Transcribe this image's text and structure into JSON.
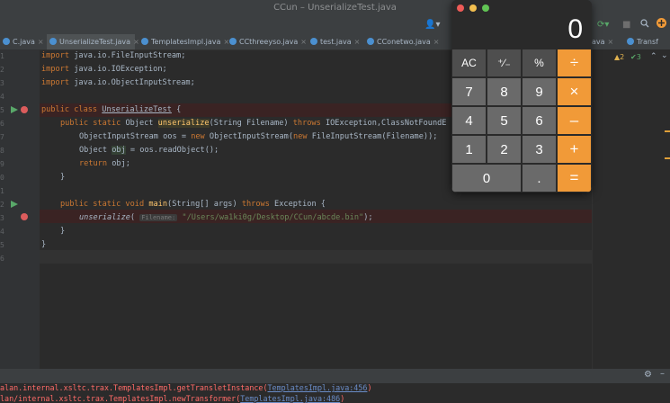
{
  "window": {
    "title": "CCun – UnserializeTest.java"
  },
  "tabs": [
    {
      "label": "C.java"
    },
    {
      "label": "UnserializeTest.java"
    },
    {
      "label": "TemplatesImpl.java"
    },
    {
      "label": "CCthreeyso.java"
    },
    {
      "label": "test.java"
    },
    {
      "label": "CConetwo.java"
    },
    {
      "label": "ava"
    },
    {
      "label": "Transf"
    }
  ],
  "inspections": {
    "warnings": "▲2",
    "ok": "✔3"
  },
  "gutter_numbers": [
    "1",
    "2",
    "3",
    "4",
    "5",
    "6",
    "7",
    "8",
    "9",
    "0",
    "1",
    "2",
    "3",
    "4",
    "5",
    "6"
  ],
  "code": {
    "l1": {
      "kw": "import",
      "rest": " java.io.FileInputStream;"
    },
    "l2": {
      "kw": "import",
      "rest": " java.io.IOException;"
    },
    "l3": {
      "kw": "import",
      "rest": " java.io.ObjectInputStream;"
    },
    "l5": {
      "kw": "public class",
      "name": "UnserializeTest",
      "rest": " {"
    },
    "l6": {
      "kw": "public static",
      "type": " Object ",
      "name": "unserialize",
      "params": "(String Filename) ",
      "throws": "throws",
      "rest": " IOException,ClassNotFoundE"
    },
    "l7": {
      "pre": "ObjectInputStream oos = ",
      "kw": "new",
      "mid": " ObjectInputStream(",
      "kw2": "new",
      "rest": " FileInputStream(Filename));"
    },
    "l8": {
      "pre": "Object ",
      "var": "obj",
      "rest": " = oos.readObject();"
    },
    "l9": {
      "kw": "return",
      "rest": " obj;"
    },
    "l10": "}",
    "l12": {
      "kw": "public static void",
      "name": "main",
      "params": "(String[] args) ",
      "throws": "throws",
      "rest": " Exception {"
    },
    "l13": {
      "name": "unserialize",
      "open": "(",
      "hint": "Filename:",
      "str": "\"/Users/wa1ki0g/Desktop/CCun/abcde.bin\"",
      "close": ");"
    },
    "l14": "}",
    "l15": "}"
  },
  "console": {
    "line1_prefix": "alan.internal.xsltc.trax.TemplatesImpl.getTransletInstance(",
    "line1_link": "TemplatesImpl.java:456",
    "line1_suffix": ")",
    "line2_prefix": "lan/internal.xsltc.trax.TemplatesImpl.newTransformer(",
    "line2_link": "TemplatesImpl.java:486",
    "line2_suffix": ")"
  },
  "calculator": {
    "display": "0",
    "keys": {
      "ac": "AC",
      "sign": "⁺∕₋",
      "percent": "%",
      "divide": "÷",
      "seven": "7",
      "eight": "8",
      "nine": "9",
      "multiply": "×",
      "four": "4",
      "five": "5",
      "six": "6",
      "minus": "–",
      "one": "1",
      "two": "2",
      "three": "3",
      "plus": "+",
      "zero": "0",
      "dot": ".",
      "equals": "="
    },
    "colors": {
      "operator": "#f19a38",
      "function": "#4e4e4e",
      "number": "#6a6a6a"
    }
  },
  "colors": {
    "editor_bg": "#2b2b2b",
    "keyword": "#cc7832",
    "function": "#ffc66d",
    "string": "#6a8759",
    "error": "#ff6b68"
  }
}
